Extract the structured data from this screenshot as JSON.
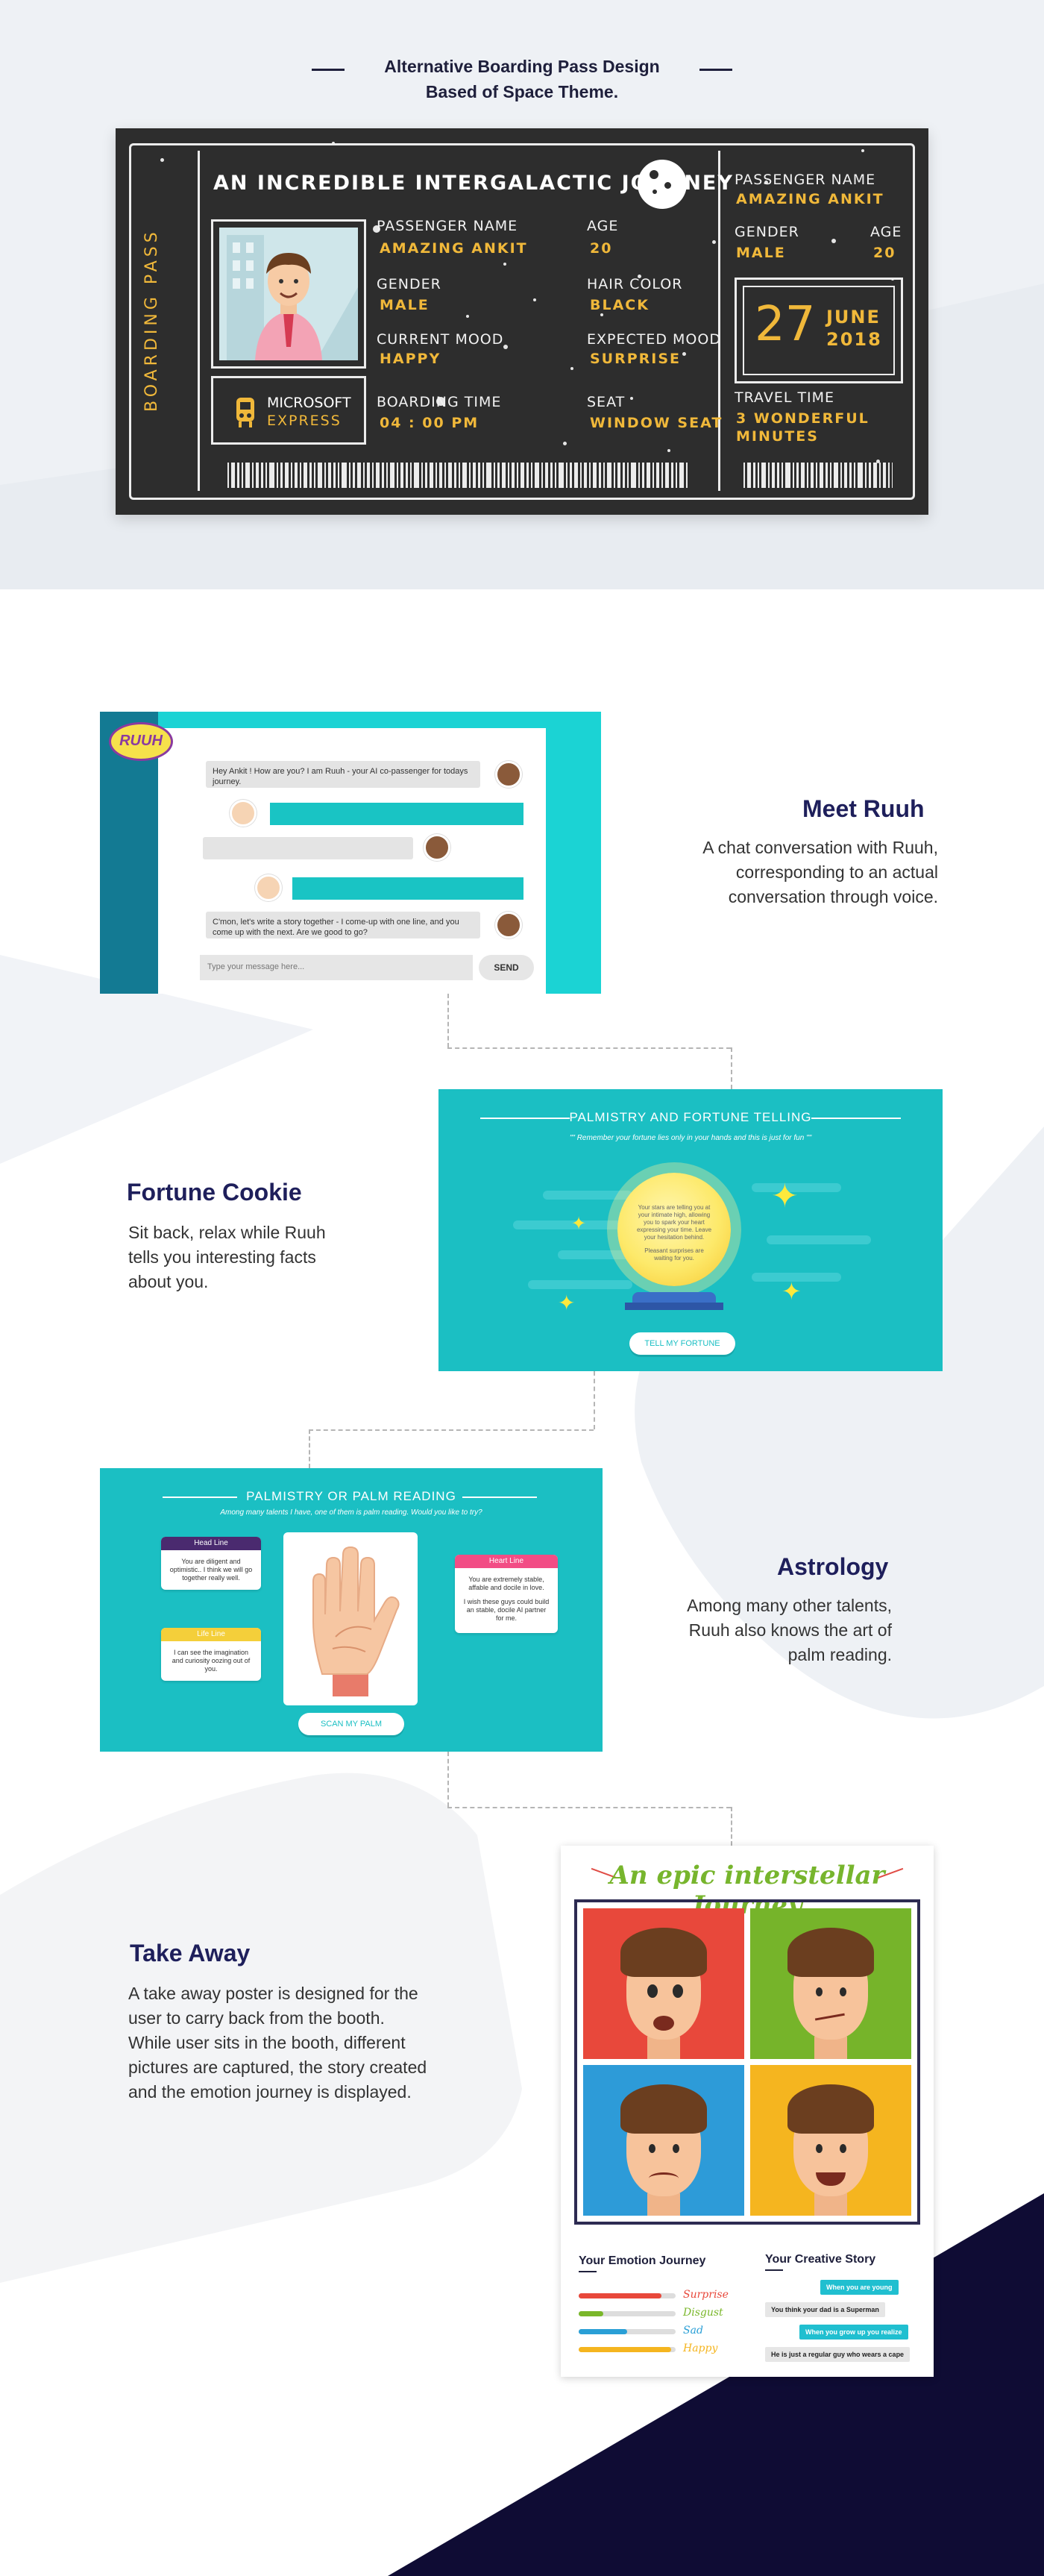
{
  "header": {
    "line1": "Alternative Boarding Pass Design",
    "line2": "Based of Space Theme."
  },
  "boarding_pass": {
    "side_label": "BOARDING PASS",
    "title": "AN INCREDIBLE INTERGALACTIC JOURNEY",
    "logo_top": "MICROSOFT",
    "logo_bottom": "EXPRESS",
    "fields": {
      "passenger_label": "PASSENGER NAME",
      "passenger_value": "AMAZING ANKIT",
      "age_label": "AGE",
      "age_value": "20",
      "gender_label": "GENDER",
      "gender_value": "MALE",
      "hair_label": "HAIR COLOR",
      "hair_value": "BLACK",
      "mood_label": "CURRENT MOOD",
      "mood_value": "HAPPY",
      "expected_label": "EXPECTED MOOD",
      "expected_value": "SURPRISE",
      "boarding_label": "BOARDING TIME",
      "boarding_value": "04 : 00 PM",
      "seat_label": "SEAT",
      "seat_value": "WINDOW SEAT"
    },
    "stub": {
      "passenger_label": "PASSENGER NAME",
      "passenger_value": "AMAZING ANKIT",
      "gender_label": "GENDER",
      "gender_value": "MALE",
      "age_label": "AGE",
      "age_value": "20",
      "day": "27",
      "month": "JUNE",
      "year": "2018",
      "travel_label": "TRAVEL TIME",
      "travel_value_1": "3 WONDERFUL",
      "travel_value_2": "MINUTES"
    }
  },
  "meet_ruuh": {
    "title": "Meet Ruuh",
    "text_1": "A chat conversation with Ruuh,",
    "text_2": "corresponding to an actual",
    "text_3": "conversation through voice.",
    "chat": {
      "logo": "RUUH",
      "msg_1": "Hey Ankit ! How are you? I am Ruuh - your AI co-passenger for todays journey.",
      "msg_2": "C'mon, let's write a story together - I come-up with one line, and you come up with the next. Are we good to go?",
      "input_placeholder": "Type your message here...",
      "send": "SEND"
    }
  },
  "fortune": {
    "title": "Fortune Cookie",
    "text_1": "Sit back, relax while Ruuh",
    "text_2": "tells you interesting facts",
    "text_3": "about you.",
    "card": {
      "heading": "PALMISTRY AND FORTUNE TELLING",
      "sub": "\"\" Remember your fortune lies only in your hands and this is just for fun \"\"",
      "ball_1": "Your stars are telling you at your intimate high, allowing you to spark your heart expressing your time. Leave your hesitation behind.",
      "ball_2": "Pleasant surprises are waiting for you.",
      "button": "TELL MY FORTUNE"
    }
  },
  "astrology": {
    "title": "Astrology",
    "text_1": "Among many other talents,",
    "text_2": "Ruuh also knows the art of",
    "text_3": "palm reading.",
    "card": {
      "heading": "PALMISTRY OR PALM READING",
      "sub": "Among many talents I have, one of them is palm reading. Would you like to try?",
      "head_tag": "Head Line",
      "head_text": "You are diligent and optimistic.. I think we will go together really well.",
      "life_tag": "Life Line",
      "life_text": "I can see the imagination and curiosity oozing out of you.",
      "heart_tag": "Heart Line",
      "heart_text_1": "You are extremely stable, affable and docile in love.",
      "heart_text_2": "I wish these guys could build an stable, docile AI partner for me.",
      "button": "SCAN MY PALM"
    }
  },
  "take_away": {
    "title": "Take Away",
    "text_1": "A take away poster is designed for the",
    "text_2": "user to carry back from the booth.",
    "text_3": "While user sits in the booth, different",
    "text_4": "pictures are captured, the story created",
    "text_5": "and the emotion journey is displayed.",
    "poster": {
      "title": "An epic interstellar Journey",
      "emotion_head": "Your Emotion Journey",
      "story_head": "Your Creative Story",
      "emotions": [
        {
          "label": "Surprise",
          "level": 0.85,
          "color": "#e8483b"
        },
        {
          "label": "Disgust",
          "level": 0.25,
          "color": "#7ab72a"
        },
        {
          "label": "Sad",
          "level": 0.5,
          "color": "#2a9fd6"
        },
        {
          "label": "Happy",
          "level": 0.95,
          "color": "#f5b51f"
        }
      ],
      "story": [
        "When you are young",
        "You think your dad is a Superman",
        "When you grow up you realize",
        "He is just a regular guy who wears a cape"
      ]
    }
  },
  "colors": {
    "navy": "#1e1f5b",
    "teal": "#1bbfc3",
    "gold": "#f0b83a",
    "dark": "#2d2d2d"
  }
}
